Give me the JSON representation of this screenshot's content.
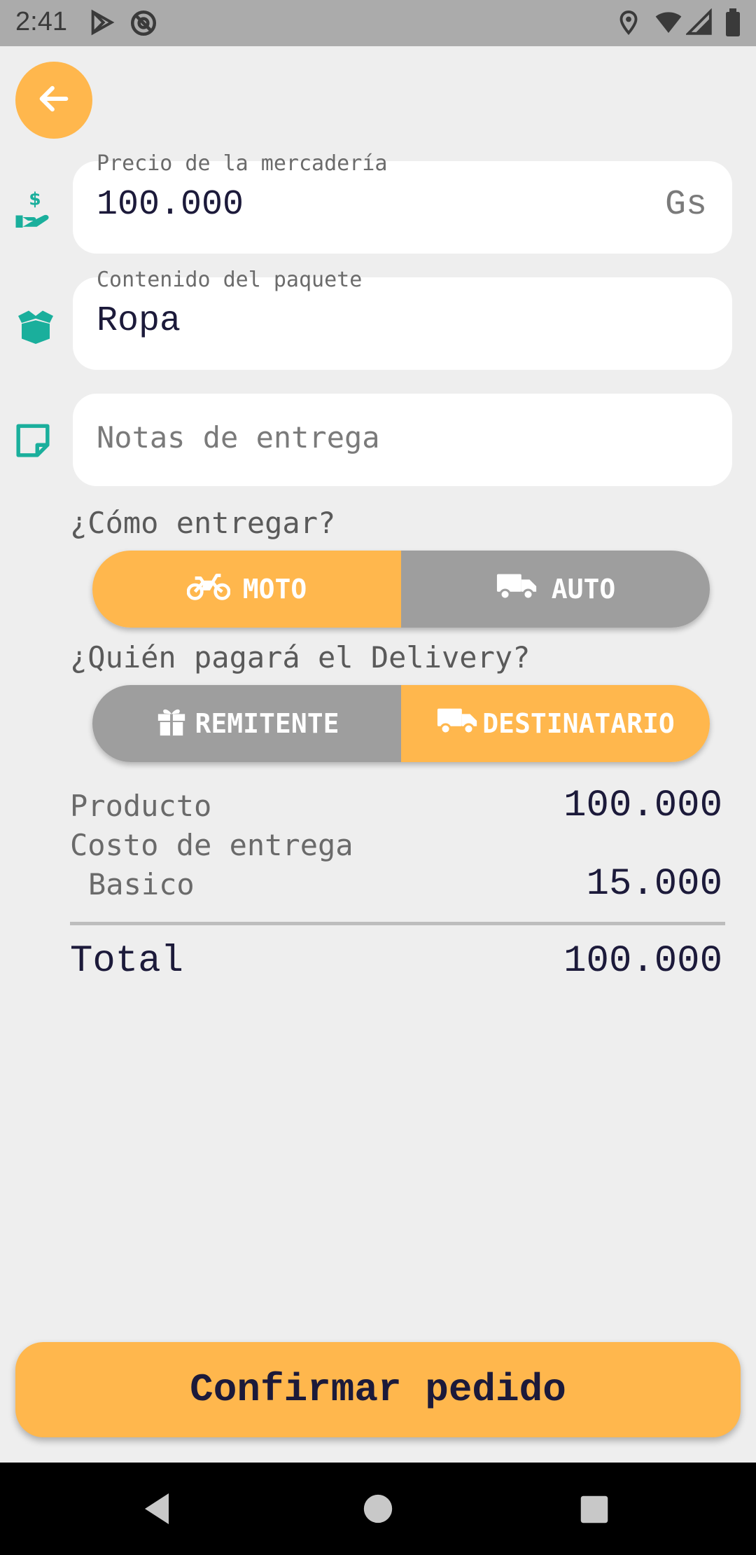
{
  "status_bar": {
    "time": "2:41"
  },
  "form": {
    "price": {
      "label": "Precio de la mercadería",
      "value": "100.000",
      "suffix": "Gs"
    },
    "content": {
      "label": "Contenido del paquete",
      "value": "Ropa"
    },
    "notes": {
      "placeholder": "Notas de entrega"
    }
  },
  "delivery_method": {
    "label": "¿Cómo entregar?",
    "options": [
      {
        "label": "MOTO",
        "icon": "motorcycle-icon",
        "selected": true
      },
      {
        "label": "AUTO",
        "icon": "truck-icon",
        "selected": false
      }
    ]
  },
  "payer": {
    "label": "¿Quién pagará el Delivery?",
    "options": [
      {
        "label": "REMITENTE",
        "icon": "gift-icon",
        "selected": false
      },
      {
        "label": "DESTINATARIO",
        "icon": "truck-icon",
        "selected": true
      }
    ]
  },
  "summary": {
    "product_label": "Producto",
    "product_value": "100.000",
    "delivery_cost_label": "Costo de entrega",
    "delivery_type_label": "Basico",
    "delivery_value": "15.000",
    "total_label": "Total",
    "total_value": "100.000"
  },
  "confirm_label": "Confirmar pedido",
  "colors": {
    "accent": "#ffb74d",
    "inactive": "#9e9e9e",
    "icon_teal": "#1aaf9c",
    "text_dark": "#1c1a3a",
    "background": "#eeeeee"
  }
}
